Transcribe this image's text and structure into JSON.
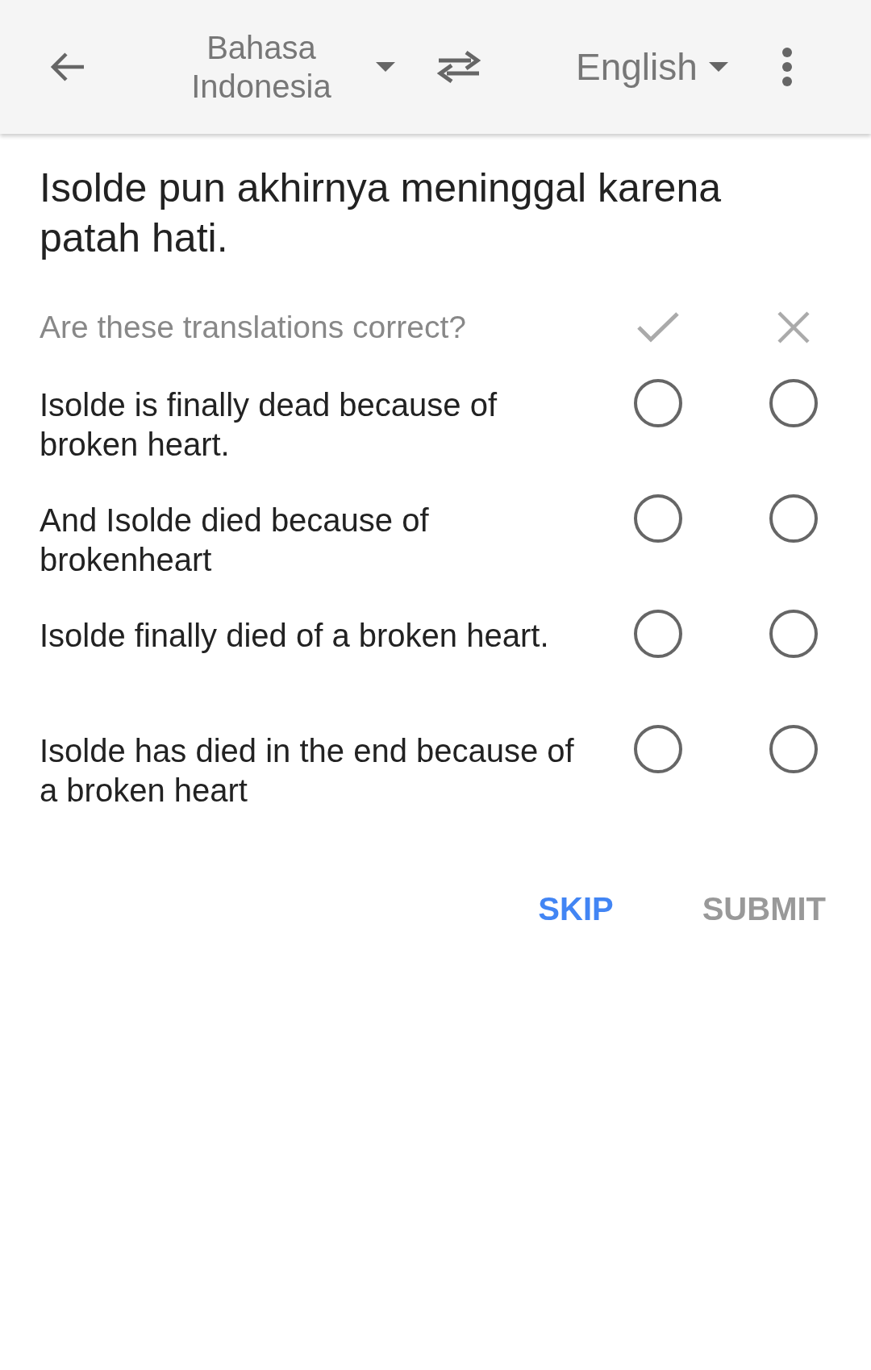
{
  "toolbar": {
    "source_language": "Bahasa Indonesia",
    "target_language": "English"
  },
  "source_text": "Isolde pun akhirnya meninggal karena patah hati.",
  "question": "Are these translations correct?",
  "translations": [
    {
      "text": "Isolde is finally dead because of broken heart.",
      "options": [
        {
          "selected": false
        },
        {
          "selected": false
        }
      ]
    },
    {
      "text": "And Isolde died because of brokenheart",
      "options": [
        {
          "selected": false
        },
        {
          "selected": false
        }
      ]
    },
    {
      "text": "Isolde finally died of a broken heart.",
      "options": [
        {
          "selected": false
        },
        {
          "selected": false
        }
      ]
    },
    {
      "text": "Isolde has died in the end because of a broken heart",
      "options": [
        {
          "selected": false
        },
        {
          "selected": false
        }
      ]
    }
  ],
  "buttons": [
    {
      "label": "SKIP",
      "disabled": false
    },
    {
      "label": "SUBMIT",
      "disabled": true
    }
  ]
}
